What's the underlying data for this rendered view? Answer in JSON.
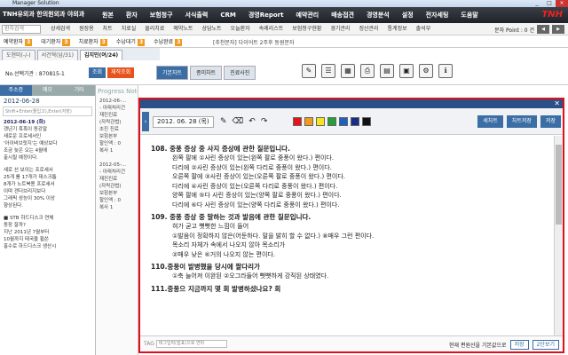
{
  "window": {
    "title": "Manager Solution"
  },
  "menubar": {
    "logo": "TNH유외과 한의원외과 야외과",
    "items": [
      "원본",
      "환자",
      "보험청구",
      "서식출력",
      "CRM",
      "경영Report",
      "예약관리",
      "배송접견",
      "경영분석",
      "설정",
      "전자세팅",
      "도움말"
    ],
    "brand": "TNH"
  },
  "subbar": {
    "search_placeholder": "환자검색",
    "items": [
      "상세검색",
      "원장용",
      "차트",
      "치료실",
      "물리치료",
      "예약노트",
      "상담노트",
      "오늘환자",
      "속례리스트",
      "보험청구현황",
      "경기관리",
      "정산관리",
      "통계정보",
      "출석부"
    ],
    "points_label": "문자 Point : 0 건"
  },
  "statusbar": {
    "items": [
      {
        "label": "예약환자",
        "count": "3"
      },
      {
        "label": "대기환자",
        "count": "3"
      },
      {
        "label": "치료환자",
        "count": "3"
      },
      {
        "label": "수납대기",
        "count": "3"
      },
      {
        "label": "수납완료",
        "count": "3"
      }
    ],
    "title": "[추천문자] 다이어트 2주후 동원문자"
  },
  "patient_tabs": [
    "도현미(-/-)",
    "서건혁(남/31)",
    "김지민(여/24)"
  ],
  "patient": {
    "no_label": "No.선택기관 : 870815-1",
    "buttons": [
      "조회",
      "재작조회"
    ],
    "tabs": [
      "기본차트",
      "종미차트",
      "진료사진"
    ]
  },
  "left_panel": {
    "tabs": [
      "주소증",
      "메모",
      "기타"
    ],
    "date": "2012-06-28",
    "hint": "Shift+Enter(줄입고),Enter(저장)",
    "entries": [
      {
        "date": "2012-06-19 (화)",
        "lines": [
          "갱년기 흑흑이 동강말",
          "새로운 프로세서인",
          "'아이비브릿지'는 예상보다",
          "조금 늦은 오는 4월에",
          "출시될 예정이다."
        ]
      },
      {
        "date": "",
        "lines": [
          "새로 선 보이는 프로세서",
          "25개 를 17개가 데스크톱",
          "8개가 노트북용 프로세서",
          "이며 갠더브리지보다",
          "그래픽 성능이 30% 이상",
          "향상된다."
        ]
      },
      {
        "date": "",
        "lines": [
          "■ STB 하드디스크 연체",
          "동장 잘까?",
          "지난 2011년 7월부터",
          "10월까지 태국을 휩쓴",
          "홍수로 하드디스크 생산시"
        ]
      }
    ]
  },
  "middle": {
    "header": "Progress Note",
    "lines": [
      "2012-06-...",
      "- 아래처리건",
      "재진진료",
      "(자락관법)",
      "초진 진료",
      "보험본부",
      "할인액 : 0",
      "복사 1",
      "2012-05-...",
      "- 아래처리건",
      "재진진료",
      "(자락관법)",
      "보험본부",
      "할인액 : 0",
      "복사 1"
    ]
  },
  "modal": {
    "date": "2012. 06. 28 (목)",
    "colors": [
      "#e4141a",
      "#f39a1e",
      "#f5e61b",
      "#25a038",
      "#1e5fbf",
      "#1b2c85",
      "#111111"
    ],
    "buttons": [
      "세차트",
      "차트저장",
      "저장"
    ],
    "doc": [
      {
        "type": "q",
        "text": "108. 중풍 증상 중 사지 증상에 관한 질문입니다."
      },
      {
        "type": "a",
        "text": "왼쪽     팔에    ①사린 증상이 있는(왼쪽 팔로 중풍이 왔다.) 편이다."
      },
      {
        "type": "a",
        "text": "           다리에  ②사린 증상이 있는(왼쪽 다리로 중풍이 왔다.) 편이다."
      },
      {
        "type": "a",
        "text": "오른쪽   팔에    ③사린 증상이 있는(오른쪽 팔로 중풍이 왔다.) 편이다."
      },
      {
        "type": "a",
        "text": "           다리에  ④사린 증상이 있는(오른쪽 다리로 중풍이 왔다.) 편이다."
      },
      {
        "type": "a",
        "text": "양쪽     팔에    ⑤다 사린 증상이 있는(양쪽 팔로 중풍이 왔다.) 편이다."
      },
      {
        "type": "a",
        "text": "           다리에  ⑥다 사린 증상이 있는(양쪽 다리로 중풍이 왔다.) 편이다."
      },
      {
        "type": "q",
        "text": "109. 중풍 증상 중 말하는 것과 발음에 관한 질문입니다."
      },
      {
        "type": "a",
        "text": "혀가 굳고 뻣뻣한 느낌이 들어"
      },
      {
        "type": "a",
        "text": "     ①발음이 정확하지 않은(어둔하다. 말을 밝히 할 수 없다.) ⑧매우 그런 편이다."
      },
      {
        "type": "a",
        "text": "목소리 자체가 속에서 나오지 않아 목소리가"
      },
      {
        "type": "a",
        "text": "     ②매우 낮은        ⑥거의 나오지 않는 편이다."
      },
      {
        "type": "q",
        "text": "110.중풍이 발병했을 당시에 팔다리가"
      },
      {
        "type": "a",
        "text": "     ①축 늘어져 이완된  ②오그라들어 뻣뻣하게 강직된 상태였다."
      },
      {
        "type": "q",
        "text": "111.중풍으 지금까지 몇 회 발병하셨나요?        회"
      }
    ],
    "tag_label": "TAG",
    "tag_placeholder": "태그입력(쉼표)으로 연마",
    "footer_text": "현재 편원선을 기본값으로",
    "save_label": "저장",
    "view_label": "2단보기"
  }
}
